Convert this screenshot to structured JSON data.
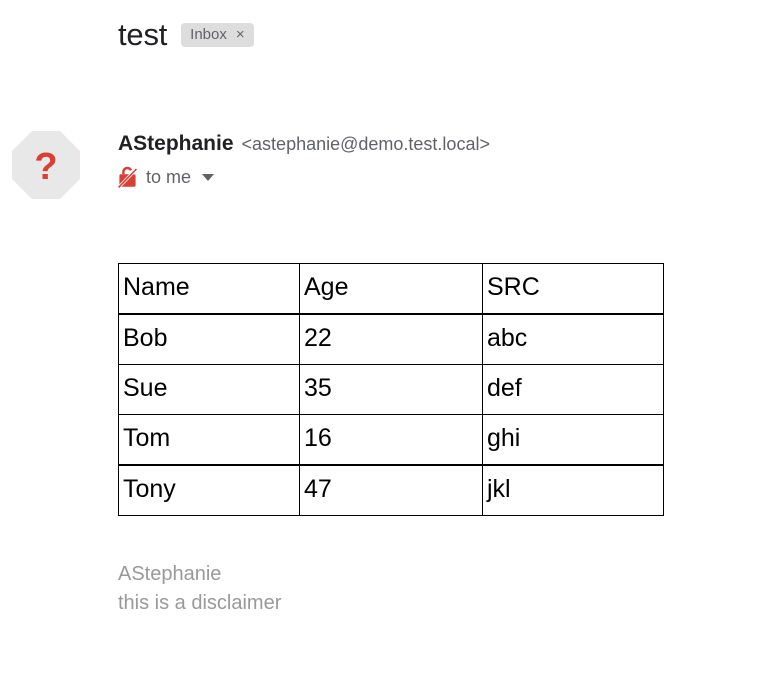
{
  "email": {
    "subject": "test",
    "label": {
      "name": "Inbox",
      "close": "×"
    },
    "avatar": {
      "icon": "question-mark-octagon",
      "glyph": "?",
      "shape_color": "#e8e8e8",
      "glyph_color": "#d93f34"
    },
    "sender": {
      "name": "AStephanie",
      "address": "<astephanie@demo.test.local>"
    },
    "recipients": {
      "security_icon": "no-encryption-icon",
      "security_icon_color": "#d93f34",
      "text": "to me",
      "expand_icon": "chevron-down-icon"
    },
    "body": {
      "table": {
        "headers": [
          "Name",
          "Age",
          "SRC"
        ],
        "rows": [
          {
            "name": "Bob",
            "age": "22",
            "src": "abc"
          },
          {
            "name": "Sue",
            "age": "35",
            "src": "def"
          },
          {
            "name": "Tom",
            "age": "16",
            "src": "ghi"
          },
          {
            "name": "Tony",
            "age": "47",
            "src": "jkl"
          }
        ]
      },
      "signature": [
        "AStephanie",
        "this is a disclaimer"
      ]
    }
  }
}
